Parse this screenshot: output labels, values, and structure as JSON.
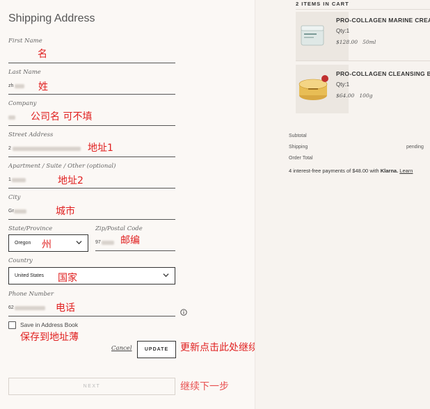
{
  "form": {
    "title": "Shipping Address",
    "first_name": {
      "label": "First Name",
      "annotation": "名"
    },
    "last_name": {
      "label": "Last Name",
      "value": "zh",
      "annotation": "姓"
    },
    "company": {
      "label": "Company",
      "annotation": "公司名 可不填"
    },
    "street": {
      "label": "Street Address",
      "value": "2",
      "annotation": "地址1"
    },
    "apartment": {
      "label": "Apartment / Suite / Other (optional)",
      "value": "1",
      "annotation": "地址2"
    },
    "city": {
      "label": "City",
      "value": "Gr",
      "annotation": "城市"
    },
    "state": {
      "label": "State/Province",
      "value": "Oregon",
      "annotation": "州"
    },
    "zip": {
      "label": "Zip/Postal Code",
      "value": "97",
      "annotation": "邮编"
    },
    "country": {
      "label": "Country",
      "value": "United States",
      "annotation": "国家"
    },
    "phone": {
      "label": "Phone Number",
      "value": "62",
      "annotation": "电话"
    },
    "save_address": {
      "label": "Save in Address Book",
      "annotation": "保存到地址薄"
    },
    "cancel_label": "Cancel",
    "update_label": "UPDATE",
    "update_annotation": "更新点击此处继续一步",
    "next_label": "NEXT",
    "next_annotation": "继续下一步"
  },
  "cart": {
    "header": "2 ITEMS IN CART",
    "items": [
      {
        "name": "PRO-COLLAGEN MARINE CREAM",
        "qty": "Qty:1",
        "price": "$128.00",
        "size": "50ml",
        "image_icon": "cream-jar-icon"
      },
      {
        "name": "PRO-COLLAGEN CLEANSING BALM",
        "qty": "Qty:1",
        "price": "$64.00",
        "size": "100g",
        "image_icon": "balm-jar-icon"
      }
    ],
    "summary": {
      "subtotal_label": "Subtotal",
      "shipping_label": "Shipping",
      "shipping_value": "pending",
      "order_total_label": "Order Total"
    },
    "klarna": {
      "text": "4 interest-free payments of $48.00 with",
      "brand": "Klarna.",
      "link": "Learn"
    }
  },
  "colors": {
    "annotation": "#e02020",
    "background": "#fbf8f5",
    "panel": "#f7f3ef"
  }
}
